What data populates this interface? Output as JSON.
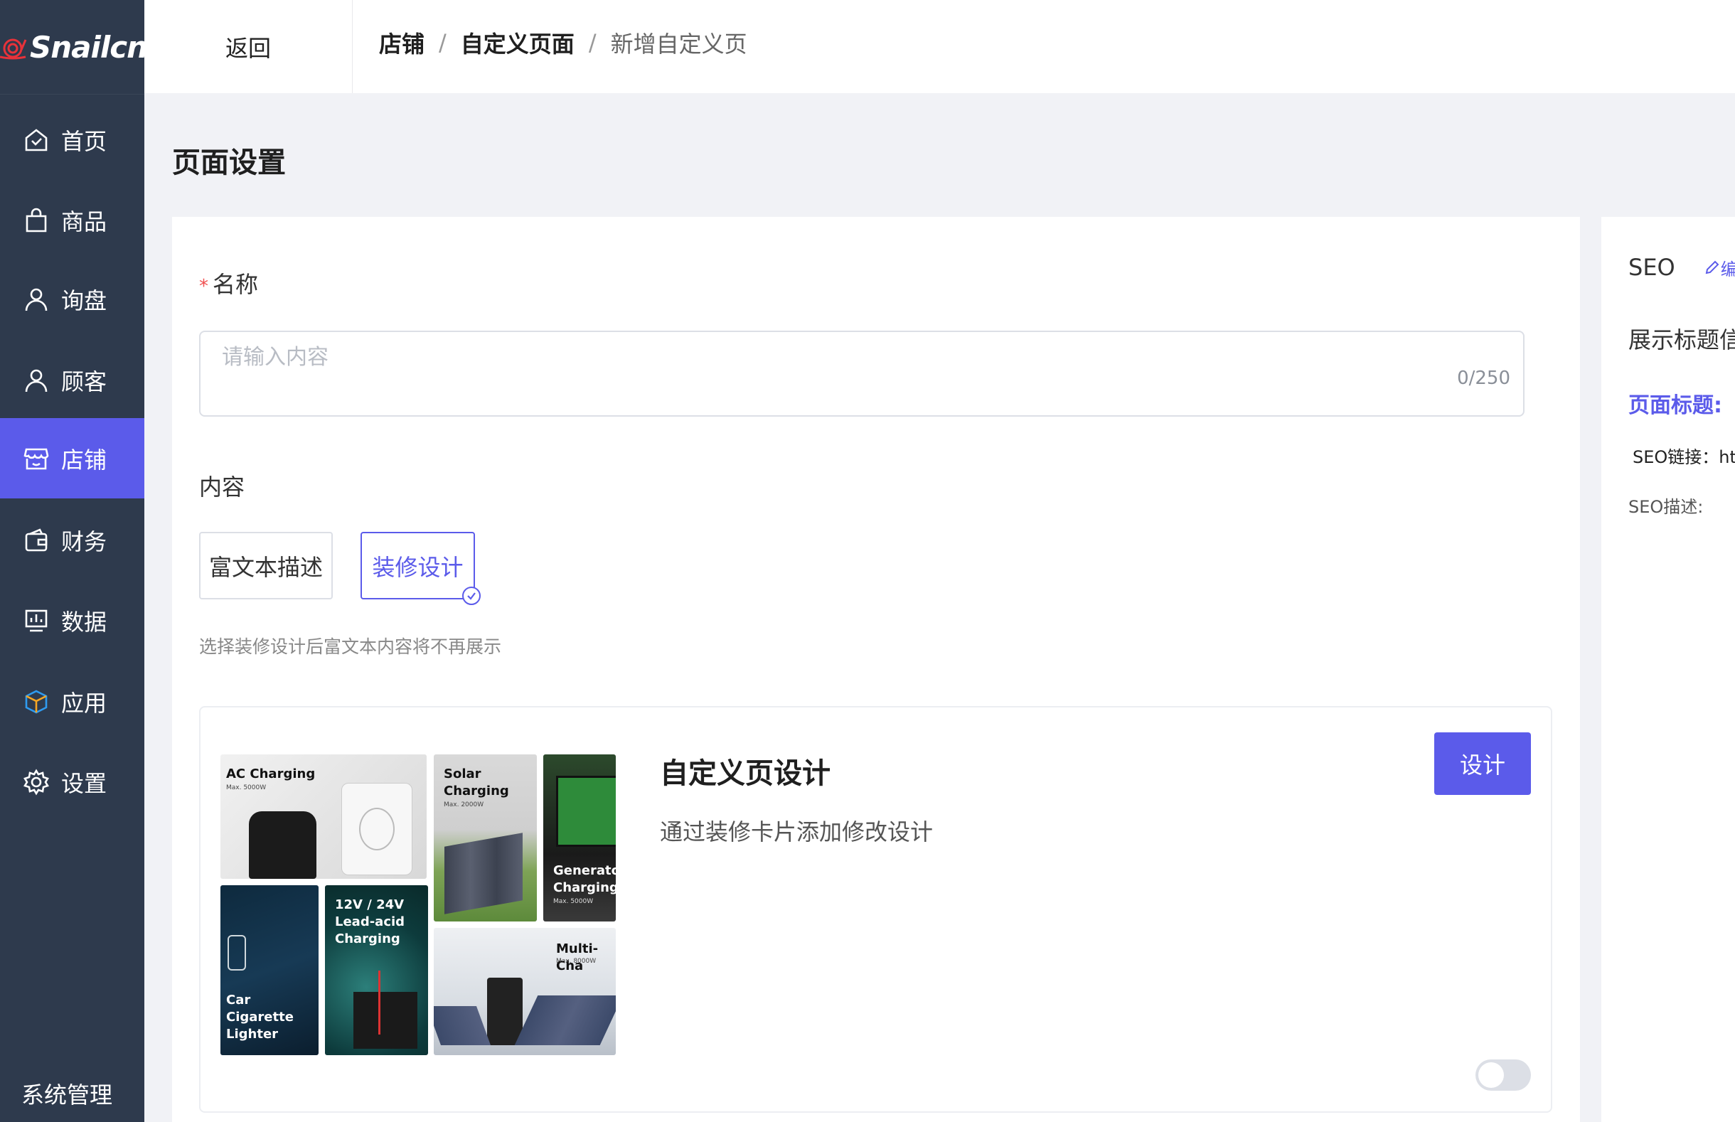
{
  "brand": {
    "logo_text": "Snailcn"
  },
  "sidebar": {
    "items": [
      {
        "label": "首页",
        "icon": "home-icon"
      },
      {
        "label": "商品",
        "icon": "shopping-bag-icon"
      },
      {
        "label": "询盘",
        "icon": "user-icon"
      },
      {
        "label": "顾客",
        "icon": "user-icon"
      },
      {
        "label": "店铺",
        "icon": "store-icon",
        "active": true
      },
      {
        "label": "财务",
        "icon": "wallet-icon"
      },
      {
        "label": "数据",
        "icon": "chart-icon"
      },
      {
        "label": "应用",
        "icon": "cube-icon"
      },
      {
        "label": "设置",
        "icon": "gear-icon"
      }
    ],
    "footer": "系统管理"
  },
  "topbar": {
    "back": "返回",
    "breadcrumb": [
      "店铺",
      "自定义页面",
      "新增自定义页"
    ],
    "separator": "/"
  },
  "page": {
    "title": "页面设置",
    "name_label": "名称",
    "required_mark": "*",
    "name_placeholder": "请输入内容",
    "name_counter": "0/250",
    "content_label": "内容",
    "options": [
      "富文本描述",
      "装修设计"
    ],
    "hint": "选择装修设计后富文本内容将不再展示",
    "design": {
      "title": "自定义页设计",
      "desc": "通过装修卡片添加修改设计",
      "button": "设计",
      "enabled": false
    },
    "tiles": {
      "ac": {
        "title": "AC Charging",
        "sub": "Max. 5000W"
      },
      "solar": {
        "title_1": "Solar",
        "title_2": "Charging",
        "sub": "Max. 2000W"
      },
      "generator": {
        "title_1": "Generator",
        "title_2": "Charging",
        "sub": "Max. 5000W"
      },
      "car": {
        "title_1": "Car",
        "title_2": "Cigarette",
        "title_3": "Lighter"
      },
      "lead": {
        "title_1": "12V / 24V",
        "title_2": "Lead-acid",
        "title_3": "Charging"
      },
      "multi": {
        "title": "Multi-Cha",
        "sub": "Max. 8000W"
      }
    }
  },
  "seo": {
    "title": "SEO",
    "edit": "编",
    "show_title": "展示标题信",
    "page_title": "页面标题:",
    "link": "SEO链接：htt",
    "desc": "SEO描述:"
  },
  "colors": {
    "sidebar": "#2e3a4d",
    "accent": "#5b5bea",
    "background": "#f1f2f6"
  }
}
